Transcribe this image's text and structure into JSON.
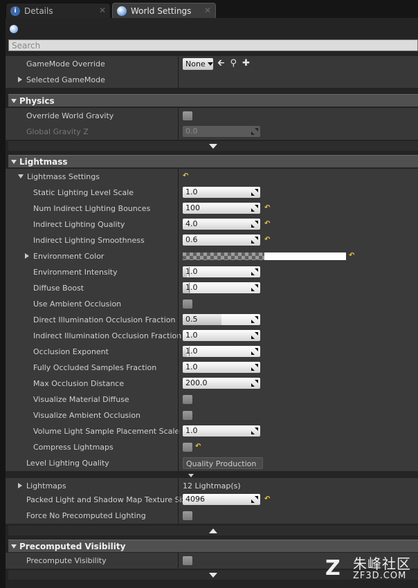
{
  "tabs": [
    {
      "label": "Details",
      "icon": "info-icon",
      "close": "✕"
    },
    {
      "label": "World Settings",
      "icon": "globe-icon",
      "close": "✕"
    }
  ],
  "search": {
    "placeholder": "Search"
  },
  "game_mode": {
    "override_label": "GameMode Override",
    "override_value": "None",
    "selected_label": "Selected GameMode"
  },
  "physics": {
    "title": "Physics",
    "override_gravity_label": "Override World Gravity",
    "global_gravity_label": "Global Gravity Z",
    "global_gravity_value": "0.0"
  },
  "lightmass": {
    "title": "Lightmass",
    "settings_label": "Lightmass Settings",
    "rows": [
      {
        "label": "Static Lighting Level Scale",
        "value": "1.0",
        "type": "number",
        "reset": false
      },
      {
        "label": "Num Indirect Lighting Bounces",
        "value": "100",
        "type": "number",
        "reset": true
      },
      {
        "label": "Indirect Lighting Quality",
        "value": "4.0",
        "type": "number",
        "reset": true
      },
      {
        "label": "Indirect Lighting Smoothness",
        "value": "0.6",
        "type": "number",
        "reset": true
      },
      {
        "label": "Environment Color",
        "value": "",
        "type": "color",
        "reset": true
      },
      {
        "label": "Environment Intensity",
        "value": "1.0",
        "type": "slider",
        "fraction": 0.05,
        "reset": false
      },
      {
        "label": "Diffuse Boost",
        "value": "1.0",
        "type": "slider",
        "fraction": 0.1,
        "reset": false
      },
      {
        "label": "Use Ambient Occlusion",
        "value": "",
        "type": "check",
        "reset": false
      },
      {
        "label": "Direct Illumination Occlusion Fraction",
        "value": "0.5",
        "type": "slider",
        "fraction": 0.5,
        "reset": false
      },
      {
        "label": "Indirect Illumination Occlusion Fraction",
        "value": "1.0",
        "type": "number",
        "reset": false
      },
      {
        "label": "Occlusion Exponent",
        "value": "1.0",
        "type": "slider",
        "fraction": 0.05,
        "reset": false
      },
      {
        "label": "Fully Occluded Samples Fraction",
        "value": "1.0",
        "type": "number",
        "reset": false
      },
      {
        "label": "Max Occlusion Distance",
        "value": "200.0",
        "type": "number",
        "reset": false
      },
      {
        "label": "Visualize Material Diffuse",
        "value": "",
        "type": "check",
        "reset": false
      },
      {
        "label": "Visualize Ambient Occlusion",
        "value": "",
        "type": "check",
        "reset": false
      },
      {
        "label": "Volume Light Sample Placement Scale",
        "value": "1.0",
        "type": "number",
        "reset": false
      },
      {
        "label": "Compress Lightmaps",
        "value": "",
        "type": "check",
        "reset": true
      }
    ],
    "level_quality_label": "Level Lighting Quality",
    "level_quality_value": "Quality Production",
    "lightmaps_label": "Lightmaps",
    "lightmaps_value": "12 Lightmap(s)",
    "packed_label": "Packed Light and Shadow Map Texture Size",
    "packed_value": "4096",
    "force_label": "Force No Precomputed Lighting"
  },
  "precomputed": {
    "title": "Precomputed Visibility",
    "precompute_label": "Precompute Visibility"
  },
  "reset_glyph": "↶",
  "gm_icons": {
    "back": "🡰",
    "browse": "⚲",
    "add": "✚"
  },
  "watermark": {
    "logo": "Z",
    "cn": "朱峰社区",
    "url": "ZF3D.COM"
  }
}
